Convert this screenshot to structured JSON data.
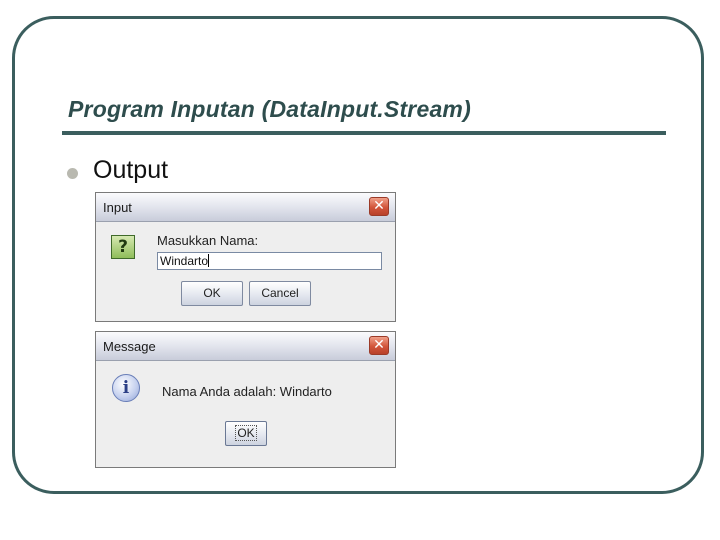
{
  "slide": {
    "title": "Program Inputan (DataInput.Stream)",
    "bullet": "Output"
  },
  "input_dialog": {
    "title": "Input",
    "prompt": "Masukkan Nama:",
    "field_value": "Windarto",
    "ok_label": "OK",
    "cancel_label": "Cancel",
    "icon_glyph": "?",
    "close_glyph": "✕"
  },
  "message_dialog": {
    "title": "Message",
    "message": "Nama Anda adalah: Windarto",
    "ok_label": "OK",
    "icon_glyph": "i",
    "close_glyph": "✕"
  },
  "colors": {
    "frame": "#3b5e5e",
    "title": "#2e4d4d",
    "close_button": "#d2553a"
  }
}
